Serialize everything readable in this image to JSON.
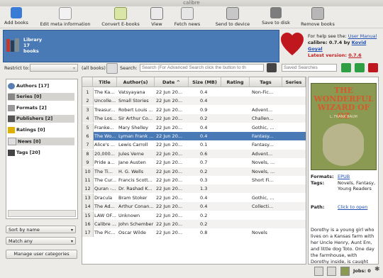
{
  "window": {
    "title": "calibre"
  },
  "toolbar": {
    "add_books": "Add books",
    "edit_meta": "Edit meta information",
    "convert": "Convert E-books",
    "view": "View",
    "fetch_news": "Fetch news",
    "send_to_device": "Send to device",
    "save_to_disk": "Save to disk",
    "remove_books": "Remove books"
  },
  "library": {
    "line1": "Library",
    "line2": "17",
    "line3": "books"
  },
  "help": {
    "prefix": "For help see the: ",
    "manual": "User Manual",
    "app_prefix": "calibre: 0.7.4 by ",
    "author": "Kovid Goyal",
    "latest_label": "Latest version: ",
    "latest_version": "0.7.6"
  },
  "search": {
    "restrict_label": "Restrict to:",
    "all_books": "(all books)",
    "search_label": "Search:",
    "placeholder": "Search (For Advanced Search click the button to th",
    "saved_placeholder": "Saved Searches"
  },
  "tag_browser": {
    "items": [
      {
        "label": "Authors [17]",
        "icon": "authors-icon"
      },
      {
        "label": "Series [0]",
        "icon": "series-icon"
      },
      {
        "label": "Formats [2]",
        "icon": "formats-icon"
      },
      {
        "label": "Publishers [2]",
        "icon": "publishers-icon"
      },
      {
        "label": "Ratings [0]",
        "icon": "ratings-icon"
      },
      {
        "label": "News [0]",
        "icon": "news-icon"
      },
      {
        "label": "Tags [20]",
        "icon": "tags-icon"
      }
    ],
    "sort_by": "Sort by name",
    "match": "Match any",
    "manage": "Manage user categories"
  },
  "table": {
    "headers": {
      "title": "Title",
      "authors": "Author(s)",
      "date": "Date",
      "size": "Size (MB)",
      "rating": "Rating",
      "tags": "Tags",
      "series": "Series"
    },
    "rows": [
      {
        "n": "1",
        "title": "The Ka...",
        "author": "Vatsyayana",
        "date": "22 Jun 20...",
        "size": "0.4",
        "rating": "",
        "tags": "Non-Fic..."
      },
      {
        "n": "2",
        "title": "Uncolle...",
        "author": "Small Stories",
        "date": "22 Jun 20...",
        "size": "0.4",
        "rating": "",
        "tags": ""
      },
      {
        "n": "3",
        "title": "Treasur...",
        "author": "Robert Louis ...",
        "date": "22 Jun 20...",
        "size": "0.9",
        "rating": "",
        "tags": "Advent..."
      },
      {
        "n": "4",
        "title": "The Los...",
        "author": "Sir Arthur Co...",
        "date": "22 Jun 20...",
        "size": "0.2",
        "rating": "",
        "tags": "Challen..."
      },
      {
        "n": "5",
        "title": "Franke...",
        "author": "Mary Shelley",
        "date": "22 Jun 20...",
        "size": "0.4",
        "rating": "",
        "tags": "Gothic, ..."
      },
      {
        "n": "6",
        "title": "The Wo...",
        "author": "Lyman Frank ...",
        "date": "22 Jun 20...",
        "size": "0.4",
        "rating": "",
        "tags": "Fantasy..."
      },
      {
        "n": "7",
        "title": "Alice's ...",
        "author": "Lewis Carroll",
        "date": "22 Jun 20...",
        "size": "0.1",
        "rating": "",
        "tags": "Fantasy..."
      },
      {
        "n": "8",
        "title": "20,000...",
        "author": "Jules Verne",
        "date": "22 Jun 20...",
        "size": "0.6",
        "rating": "",
        "tags": "Advent..."
      },
      {
        "n": "9",
        "title": "Pride a...",
        "author": "Jane Austen",
        "date": "22 Jun 20...",
        "size": "0.7",
        "rating": "",
        "tags": "Novels, ..."
      },
      {
        "n": "10",
        "title": "The Ti...",
        "author": "H. G. Wells",
        "date": "22 Jun 20...",
        "size": "0.2",
        "rating": "",
        "tags": "Novels, ..."
      },
      {
        "n": "11",
        "title": "The Cur...",
        "author": "Francis Scott...",
        "date": "22 Jun 20...",
        "size": "0.3",
        "rating": "",
        "tags": "Short Fi..."
      },
      {
        "n": "12",
        "title": "Quran -...",
        "author": "Dr. Rashad K...",
        "date": "22 Jun 20...",
        "size": "1.3",
        "rating": "",
        "tags": ""
      },
      {
        "n": "13",
        "title": "Dracula",
        "author": "Bram Stoker",
        "date": "22 Jun 20...",
        "size": "0.4",
        "rating": "",
        "tags": "Gothic, ..."
      },
      {
        "n": "14",
        "title": "The Ad...",
        "author": "Arthur Conan...",
        "date": "22 Jun 20...",
        "size": "0.4",
        "rating": "",
        "tags": "Collecti..."
      },
      {
        "n": "15",
        "title": "LAW OF...",
        "author": "Unknown",
        "date": "22 Jun 20...",
        "size": "0.2",
        "rating": "",
        "tags": ""
      },
      {
        "n": "16",
        "title": "Calibre ...",
        "author": "John Schember",
        "date": "22 Jun 20...",
        "size": "0.2",
        "rating": "",
        "tags": ""
      },
      {
        "n": "17",
        "title": "The Pic...",
        "author": "Oscar Wilde",
        "date": "22 Jun 20...",
        "size": "0.8",
        "rating": "",
        "tags": "Novels"
      }
    ],
    "selected_index": 5
  },
  "details": {
    "cover_title": "THE WONDERFUL WIZARD OF OZ",
    "cover_sub": "L. FRANK BAUM",
    "formats_label": "Formats:",
    "formats_value": "EPUB",
    "tags_label": "Tags:",
    "tags_value": "Novels, Fantasy, Young Readers",
    "path_label": "Path:",
    "path_value": "Click to open",
    "description": "Dorothy is a young girl who lives on a Kansas farm with her Uncle Henry, Aunt Em, and little dog Toto. One day the farmhouse, with Dorothy inside, is caught"
  },
  "status": {
    "jobs": "Jobs: 0"
  }
}
